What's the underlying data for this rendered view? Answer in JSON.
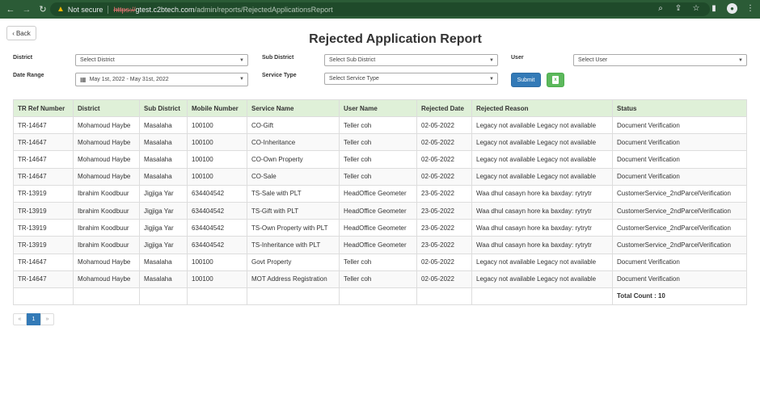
{
  "browser": {
    "not_secure": "Not secure",
    "url_scheme": "https://",
    "url_host": "gtest.c2btech.com",
    "url_path": "/admin/reports/RejectedApplicationsReport"
  },
  "page": {
    "back_label": "Back",
    "title": "Rejected Application Report"
  },
  "filters": {
    "district_label": "District",
    "district_value": "Select District",
    "subdistrict_label": "Sub District",
    "subdistrict_value": "Select Sub District",
    "user_label": "User",
    "user_value": "Select User",
    "daterange_label": "Date Range",
    "daterange_value": "May 1st, 2022 - May 31st, 2022",
    "servicetype_label": "Service Type",
    "servicetype_value": "Select Service Type",
    "submit_label": "Submit"
  },
  "table": {
    "headers": [
      "TR Ref Number",
      "District",
      "Sub District",
      "Mobile Number",
      "Service Name",
      "User Name",
      "Rejected Date",
      "Rejected Reason",
      "Status"
    ],
    "rows": [
      [
        "TR-14647",
        "Mohamoud Haybe",
        "Masalaha",
        "100100",
        "CO-Gift",
        "Teller coh",
        "02-05-2022",
        "Legacy not available Legacy not available",
        "Document Verification"
      ],
      [
        "TR-14647",
        "Mohamoud Haybe",
        "Masalaha",
        "100100",
        "CO-Inheritance",
        "Teller coh",
        "02-05-2022",
        "Legacy not available Legacy not available",
        "Document Verification"
      ],
      [
        "TR-14647",
        "Mohamoud Haybe",
        "Masalaha",
        "100100",
        "CO-Own Property",
        "Teller coh",
        "02-05-2022",
        "Legacy not available Legacy not available",
        "Document Verification"
      ],
      [
        "TR-14647",
        "Mohamoud Haybe",
        "Masalaha",
        "100100",
        "CO-Sale",
        "Teller coh",
        "02-05-2022",
        "Legacy not available Legacy not available",
        "Document Verification"
      ],
      [
        "TR-13919",
        "Ibrahim Koodbuur",
        "Jigjiga Yar",
        "634404542",
        "TS-Sale with PLT",
        "HeadOffice Geometer",
        "23-05-2022",
        "Waa dhul casayn hore ka baxday: rytrytr",
        "CustomerService_2ndParcelVerification"
      ],
      [
        "TR-13919",
        "Ibrahim Koodbuur",
        "Jigjiga Yar",
        "634404542",
        "TS-Gift with PLT",
        "HeadOffice Geometer",
        "23-05-2022",
        "Waa dhul casayn hore ka baxday: rytrytr",
        "CustomerService_2ndParcelVerification"
      ],
      [
        "TR-13919",
        "Ibrahim Koodbuur",
        "Jigjiga Yar",
        "634404542",
        "TS-Own Property with PLT",
        "HeadOffice Geometer",
        "23-05-2022",
        "Waa dhul casayn hore ka baxday: rytrytr",
        "CustomerService_2ndParcelVerification"
      ],
      [
        "TR-13919",
        "Ibrahim Koodbuur",
        "Jigjiga Yar",
        "634404542",
        "TS-Inheritance with PLT",
        "HeadOffice Geometer",
        "23-05-2022",
        "Waa dhul casayn hore ka baxday: rytrytr",
        "CustomerService_2ndParcelVerification"
      ],
      [
        "TR-14647",
        "Mohamoud Haybe",
        "Masalaha",
        "100100",
        "Govt Property",
        "Teller coh",
        "02-05-2022",
        "Legacy not available Legacy not available",
        "Document Verification"
      ],
      [
        "TR-14647",
        "Mohamoud Haybe",
        "Masalaha",
        "100100",
        "MOT Address Registration",
        "Teller coh",
        "02-05-2022",
        "Legacy not available Legacy not available",
        "Document Verification"
      ]
    ],
    "total_count": "Total Count : 10"
  },
  "pagination": {
    "prev": "«",
    "current": "1",
    "next": "»"
  }
}
